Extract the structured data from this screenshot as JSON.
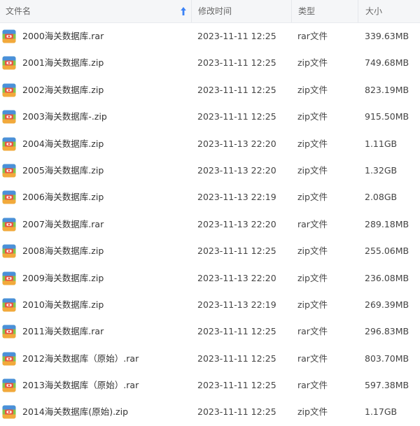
{
  "header": {
    "name": "文件名",
    "date": "修改时间",
    "type": "类型",
    "size": "大小"
  },
  "accent_colors": {
    "archive_icon_green": "#86c64a",
    "archive_icon_red": "#e8533f",
    "archive_icon_blue": "#4a90d9",
    "archive_icon_orange": "#f2a93b",
    "sort_arrow": "#3b82f6"
  },
  "files": [
    {
      "icon": "archive-icon",
      "name": "2000海关数据库.rar",
      "date": "2023-11-11 12:25",
      "type": "rar文件",
      "size": "339.63MB"
    },
    {
      "icon": "archive-icon",
      "name": "2001海关数据库.zip",
      "date": "2023-11-11 12:25",
      "type": "zip文件",
      "size": "749.68MB"
    },
    {
      "icon": "archive-icon",
      "name": "2002海关数据库.zip",
      "date": "2023-11-11 12:25",
      "type": "zip文件",
      "size": "823.19MB"
    },
    {
      "icon": "archive-icon",
      "name": "2003海关数据库-.zip",
      "date": "2023-11-11 12:25",
      "type": "zip文件",
      "size": "915.50MB"
    },
    {
      "icon": "archive-icon",
      "name": "2004海关数据库.zip",
      "date": "2023-11-13 22:20",
      "type": "zip文件",
      "size": "1.11GB"
    },
    {
      "icon": "archive-icon",
      "name": "2005海关数据库.zip",
      "date": "2023-11-13 22:20",
      "type": "zip文件",
      "size": "1.32GB"
    },
    {
      "icon": "archive-icon",
      "name": "2006海关数据库.zip",
      "date": "2023-11-13 22:19",
      "type": "zip文件",
      "size": "2.08GB"
    },
    {
      "icon": "archive-icon",
      "name": "2007海关数据库.rar",
      "date": "2023-11-13 22:20",
      "type": "rar文件",
      "size": "289.18MB"
    },
    {
      "icon": "archive-icon",
      "name": "2008海关数据库.zip",
      "date": "2023-11-11 12:25",
      "type": "zip文件",
      "size": "255.06MB"
    },
    {
      "icon": "archive-icon",
      "name": "2009海关数据库.zip",
      "date": "2023-11-13 22:20",
      "type": "zip文件",
      "size": "236.08MB"
    },
    {
      "icon": "archive-icon",
      "name": "2010海关数据库.zip",
      "date": "2023-11-13 22:19",
      "type": "zip文件",
      "size": "269.39MB"
    },
    {
      "icon": "archive-icon",
      "name": "2011海关数据库.rar",
      "date": "2023-11-11 12:25",
      "type": "rar文件",
      "size": "296.83MB"
    },
    {
      "icon": "archive-icon",
      "name": "2012海关数据库（原始）.rar",
      "date": "2023-11-11 12:25",
      "type": "rar文件",
      "size": "803.70MB"
    },
    {
      "icon": "archive-icon",
      "name": "2013海关数据库（原始）.rar",
      "date": "2023-11-11 12:25",
      "type": "rar文件",
      "size": "597.38MB"
    },
    {
      "icon": "archive-icon",
      "name": "2014海关数据库(原始).zip",
      "date": "2023-11-11 12:25",
      "type": "zip文件",
      "size": "1.17GB"
    }
  ]
}
